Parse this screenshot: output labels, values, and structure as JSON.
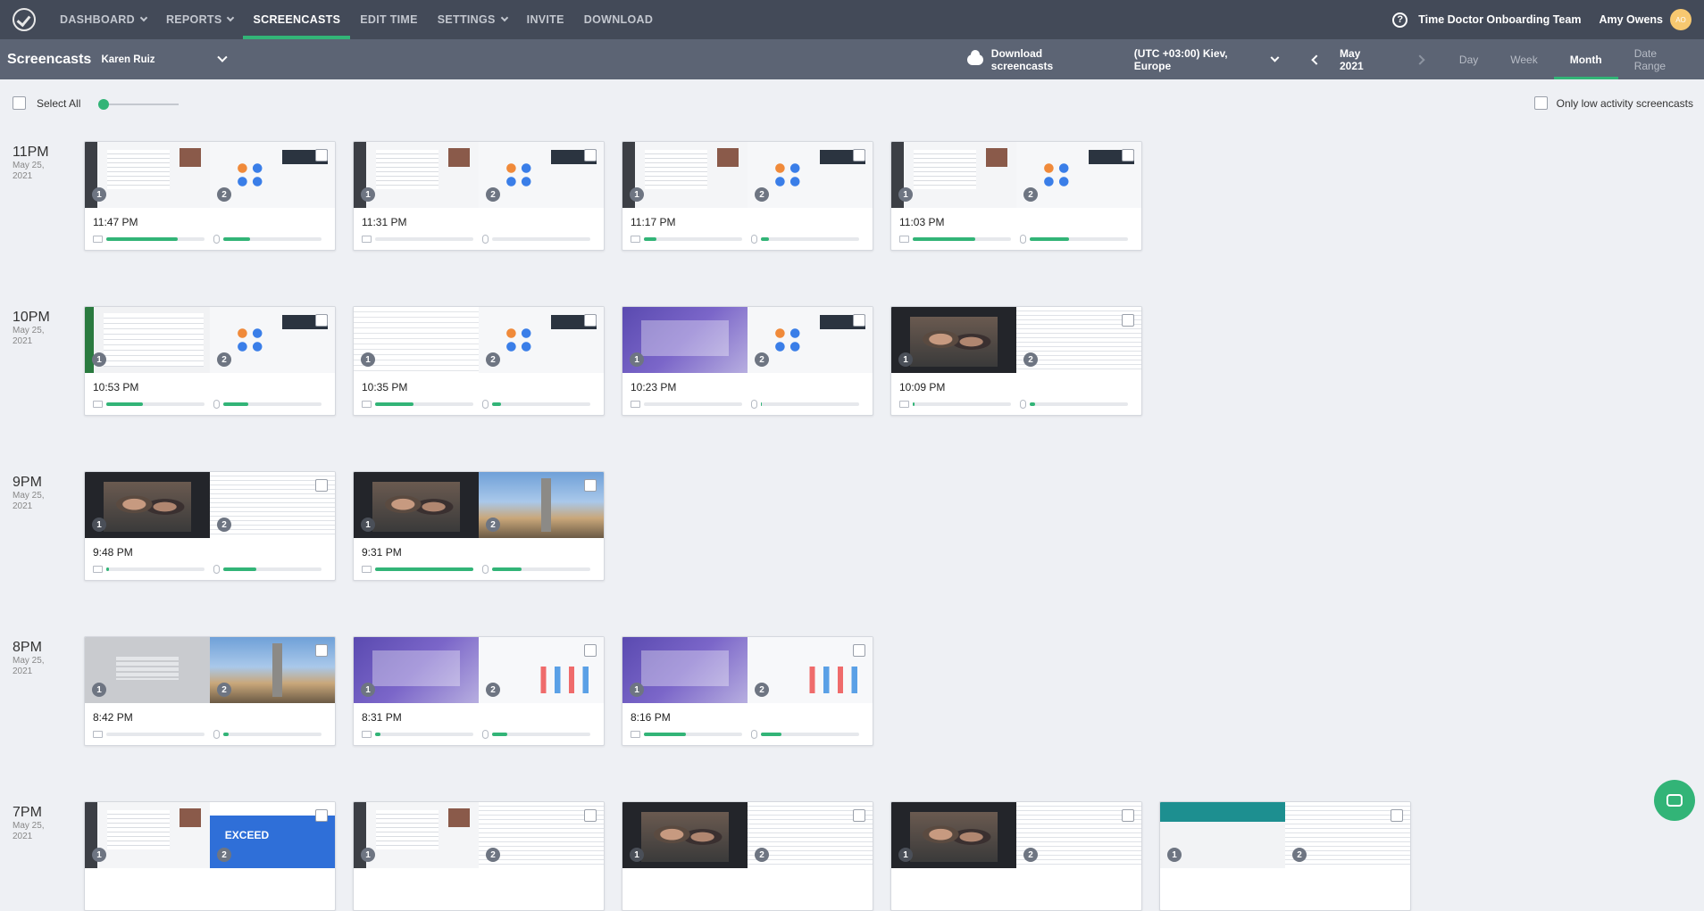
{
  "nav": {
    "items": [
      {
        "label": "DASHBOARD",
        "dropdown": true
      },
      {
        "label": "REPORTS",
        "dropdown": true
      },
      {
        "label": "SCREENCASTS",
        "active": true
      },
      {
        "label": "EDIT TIME"
      },
      {
        "label": "SETTINGS",
        "dropdown": true
      },
      {
        "label": "INVITE"
      },
      {
        "label": "DOWNLOAD"
      }
    ],
    "help": "?",
    "team": "Time Doctor Onboarding Team",
    "user": "Amy Owens",
    "avatar": "AO"
  },
  "subheader": {
    "title": "Screencasts",
    "selected_user": "Karen Ruiz",
    "download": "Download screencasts",
    "timezone": "(UTC +03:00) Kiev, Europe",
    "month": "May 2021",
    "views": [
      "Day",
      "Week",
      "Month",
      "Date Range"
    ],
    "active_view": "Month"
  },
  "toolbar": {
    "select_all": "Select All",
    "low_activity": "Only low activity screencasts",
    "zoom_level": 0
  },
  "colors": {
    "accent": "#32b477",
    "nav_bg": "#434a58",
    "subbar_bg": "#5c6474"
  },
  "groups": [
    {
      "hour": "11PM",
      "date": "May 25,",
      "year": "2021",
      "cards": [
        {
          "time": "11:47 PM",
          "kb": 0.73,
          "mouse": 0.27,
          "s1": "t-app",
          "s2": "t-zoom"
        },
        {
          "time": "11:31 PM",
          "kb": 0.0,
          "mouse": 0.0,
          "s1": "t-app",
          "s2": "t-zoom"
        },
        {
          "time": "11:17 PM",
          "kb": 0.13,
          "mouse": 0.08,
          "s1": "t-app",
          "s2": "t-zoom"
        },
        {
          "time": "11:03 PM",
          "kb": 0.64,
          "mouse": 0.4,
          "s1": "t-app",
          "s2": "t-zoom"
        }
      ]
    },
    {
      "hour": "10PM",
      "date": "May 25,",
      "year": "2021",
      "cards": [
        {
          "time": "10:53 PM",
          "kb": 0.37,
          "mouse": 0.25,
          "s1": "t-sheet",
          "s2": "t-zoom"
        },
        {
          "time": "10:35 PM",
          "kb": 0.39,
          "mouse": 0.09,
          "s1": "t-grid",
          "s2": "t-zoom"
        },
        {
          "time": "10:23 PM",
          "kb": 0.0,
          "mouse": 0.01,
          "s1": "t-purple",
          "s2": "t-zoom"
        },
        {
          "time": "10:09 PM",
          "kb": 0.02,
          "mouse": 0.05,
          "s1": "t-video",
          "s2": "t-table"
        }
      ]
    },
    {
      "hour": "9PM",
      "date": "May 25,",
      "year": "2021",
      "cards": [
        {
          "time": "9:48 PM",
          "kb": 0.03,
          "mouse": 0.34,
          "s1": "t-video",
          "s2": "t-table"
        },
        {
          "time": "9:31 PM",
          "kb": 1.0,
          "mouse": 0.3,
          "s1": "t-video",
          "s2": "t-city"
        }
      ]
    },
    {
      "hour": "8PM",
      "date": "May 25,",
      "year": "2021",
      "cards": [
        {
          "time": "8:42 PM",
          "kb": 0.0,
          "mouse": 0.05,
          "s1": "t-gray",
          "s2": "t-city"
        },
        {
          "time": "8:31 PM",
          "kb": 0.05,
          "mouse": 0.15,
          "s1": "t-purple",
          "s2": "t-chart"
        },
        {
          "time": "8:16 PM",
          "kb": 0.43,
          "mouse": 0.21,
          "s1": "t-purple",
          "s2": "t-chart"
        }
      ]
    },
    {
      "hour": "7PM",
      "date": "May 25,",
      "year": "2021",
      "cards": [
        {
          "time": "",
          "kb": 0,
          "mouse": 0,
          "s1": "t-app",
          "s2": "t-web"
        },
        {
          "time": "",
          "kb": 0,
          "mouse": 0,
          "s1": "t-app",
          "s2": "t-table"
        },
        {
          "time": "",
          "kb": 0,
          "mouse": 0,
          "s1": "t-video",
          "s2": "t-table"
        },
        {
          "time": "",
          "kb": 0,
          "mouse": 0,
          "s1": "t-video",
          "s2": "t-table"
        },
        {
          "time": "",
          "kb": 0,
          "mouse": 0,
          "s1": "t-teal",
          "s2": "t-table"
        }
      ]
    }
  ]
}
